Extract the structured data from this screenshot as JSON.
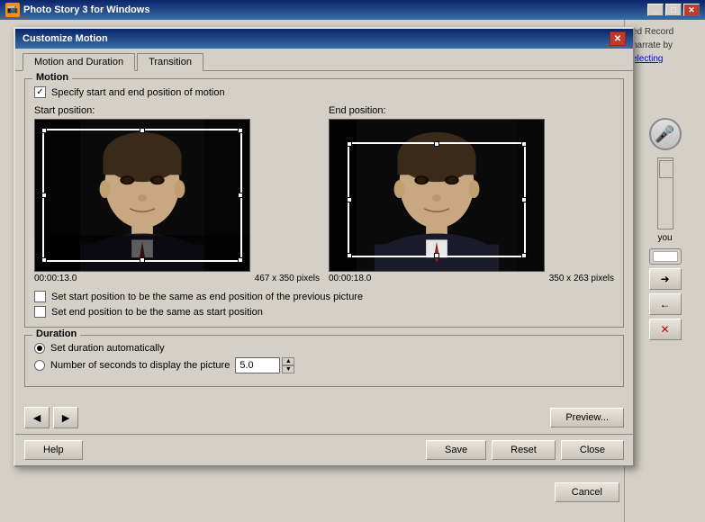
{
  "window": {
    "title": "Photo Story 3 for Windows",
    "icon": "📷"
  },
  "dialog": {
    "title": "Customize Motion",
    "tabs": [
      {
        "id": "motion",
        "label": "Motion and Duration",
        "active": true
      },
      {
        "id": "transition",
        "label": "Transition",
        "active": false
      }
    ],
    "motion_group": {
      "label": "Motion",
      "specify_checkbox_label": "Specify start and end position of motion",
      "start_label": "Start position:",
      "end_label": "End position:",
      "start_time": "00:00:13.0",
      "start_size": "467 x 350 pixels",
      "end_time": "00:00:18.0",
      "end_size": "350 x 263 pixels",
      "same_as_prev_label": "Set start position to be the same as end position of the previous picture",
      "same_as_start_label": "Set end position to be the same as start position"
    },
    "duration_group": {
      "label": "Duration",
      "auto_label": "Set duration automatically",
      "manual_label": "Number of seconds to display the picture",
      "seconds_value": "5.0"
    },
    "buttons": {
      "preview": "Preview...",
      "help": "Help",
      "save": "Save",
      "reset": "Reset",
      "close": "Close",
      "cancel": "Cancel"
    }
  },
  "right_panel": {
    "text1": "ed Record",
    "text2": "narrate by",
    "link": "electing",
    "you_text": "you"
  }
}
